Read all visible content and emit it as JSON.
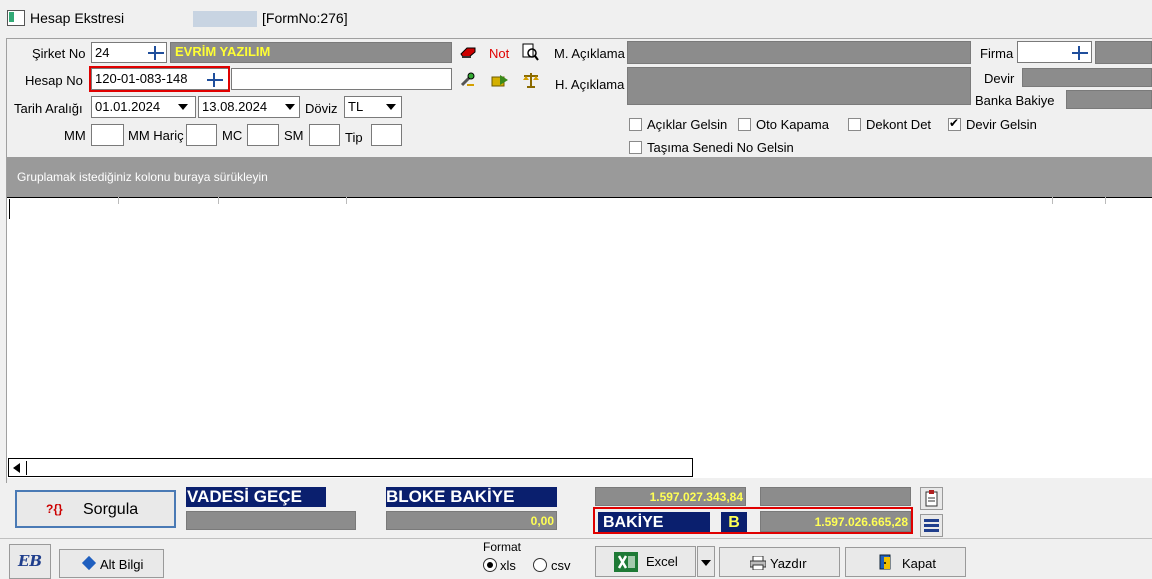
{
  "window": {
    "title": "Hesap Ekstresi",
    "form_no": "[FormNo:276]"
  },
  "filters": {
    "sirket_label": "Şirket No",
    "sirket_no": "24",
    "sirket_name": "EVRİM YAZILIM",
    "not_label": "Not",
    "hesap_label": "Hesap No",
    "hesap_no": "120-01-083-148",
    "tarih_label": "Tarih Aralığı",
    "tarih_baslangic": "01.01.2024",
    "tarih_bitis": "13.08.2024",
    "doviz_label": "Döviz",
    "doviz_value": "TL",
    "mm_label": "MM",
    "mm_haric_label": "MM Hariç",
    "mc_label": "MC",
    "sm_label": "SM",
    "tip_label": "Tip",
    "m_aciklama_label": "M. Açıklama",
    "h_aciklama_label": "H. Açıklama",
    "firma_label": "Firma",
    "devir_label": "Devir",
    "banka_bakiye_label": "Banka Bakiye"
  },
  "options": {
    "aciklar_gelsin": {
      "label": "Açıklar Gelsin",
      "checked": false
    },
    "oto_kapama": {
      "label": "Oto Kapama",
      "checked": false
    },
    "dekont_det": {
      "label": "Dekont Det",
      "checked": false
    },
    "devir_gelsin": {
      "label": "Devir Gelsin",
      "checked": true
    },
    "tasima_senedi": {
      "label": "Taşıma Senedi No Gelsin",
      "checked": false
    }
  },
  "grid": {
    "group_hint": "Gruplamak istediğiniz kolonu buraya sürükleyin"
  },
  "summary": {
    "sorgula_label": "Sorgula",
    "sorgula_icon_text": "?{}",
    "vadesi_gecen_label": "VADESİ GEÇE",
    "bloke_bakiye_label": "BLOKE BAKİYE",
    "bloke_bakiye_value": "0,00",
    "total_value": "1.597.027.343,84",
    "bakiye_label": "BAKİYE",
    "bakiye_type": "B",
    "bakiye_value": "1.597.026.665,28"
  },
  "footer": {
    "eb_logo": "EB",
    "alt_bilgi_label": "Alt Bilgi",
    "format_label": "Format",
    "format_xls": "xls",
    "format_csv": "csv",
    "format_selected": "xls",
    "excel_label": "Excel",
    "yazdir_label": "Yazdır",
    "kapat_label": "Kapat"
  },
  "colors": {
    "navy": "#0a1f6e",
    "grey_field": "#8c8c8c",
    "highlight_red": "#e00000",
    "value_yellow": "#ffff55"
  }
}
